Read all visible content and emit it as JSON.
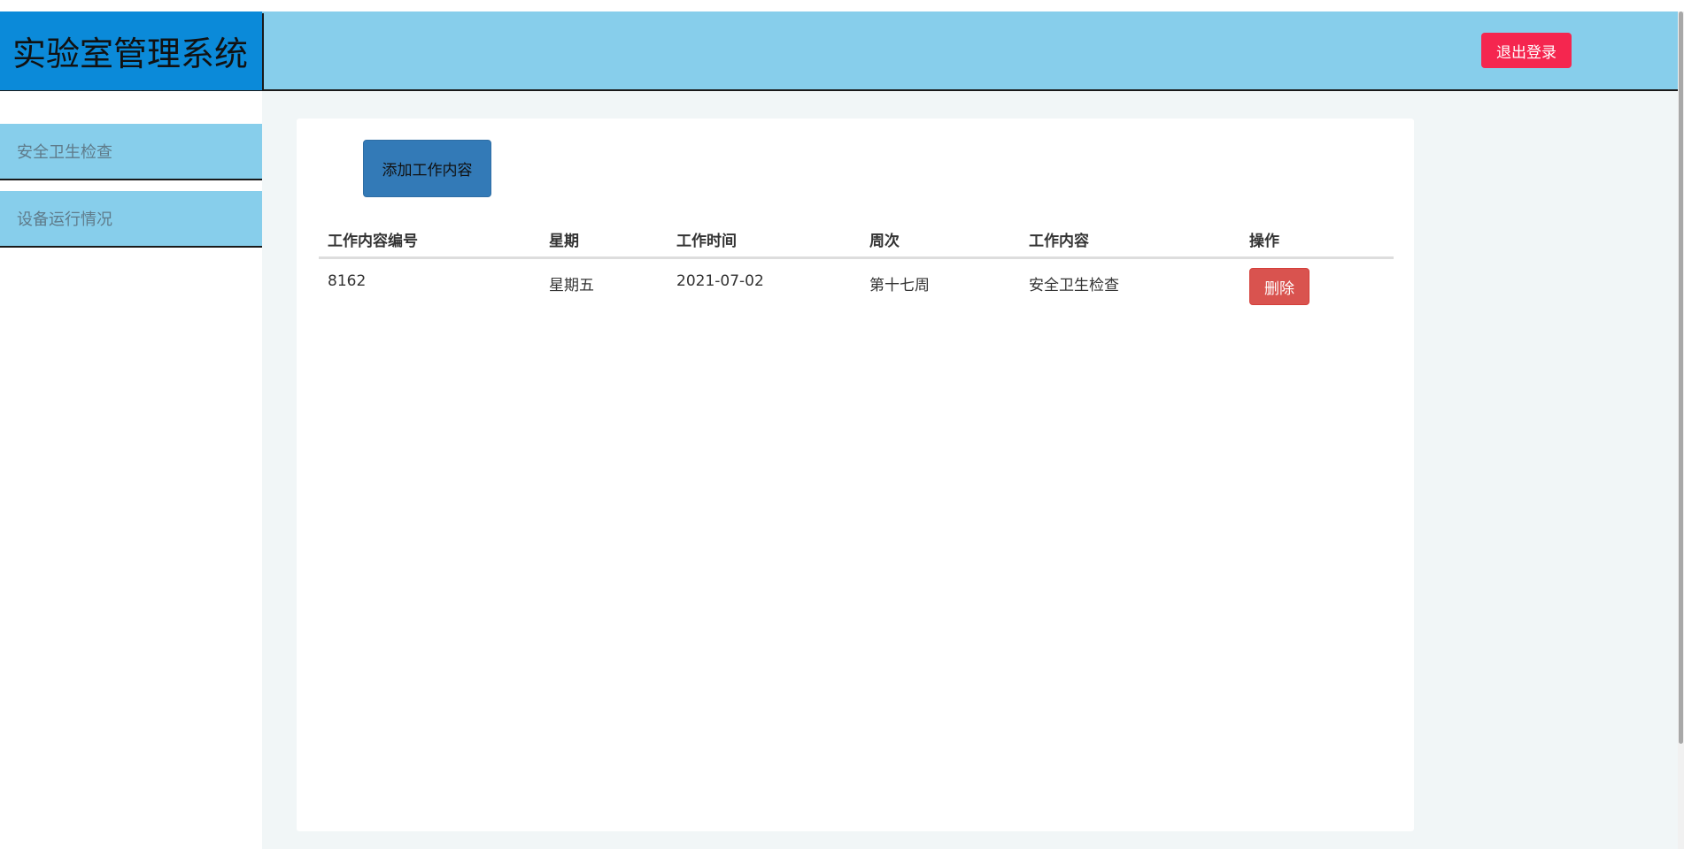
{
  "header": {
    "title": "实验室管理系统",
    "logout_label": "退出登录"
  },
  "sidebar": {
    "items": [
      {
        "label": "安全卫生检查"
      },
      {
        "label": "设备运行情况"
      }
    ]
  },
  "main": {
    "add_button_label": "添加工作内容",
    "table": {
      "columns": [
        "工作内容编号",
        "星期",
        "工作时间",
        "周次",
        "工作内容",
        "操作"
      ],
      "rows": [
        {
          "id": "8162",
          "weekday": "星期五",
          "date": "2021-07-02",
          "week": "第十七周",
          "content": "安全卫生检查",
          "action_label": "删除"
        }
      ]
    }
  },
  "colors": {
    "header_bg": "#87ceeb",
    "brand_bg": "#0b8ad9",
    "logout_bg": "#f5264f",
    "add_button_bg": "#337ab7",
    "delete_button_bg": "#d9534f",
    "main_bg": "#f1f6f7"
  }
}
